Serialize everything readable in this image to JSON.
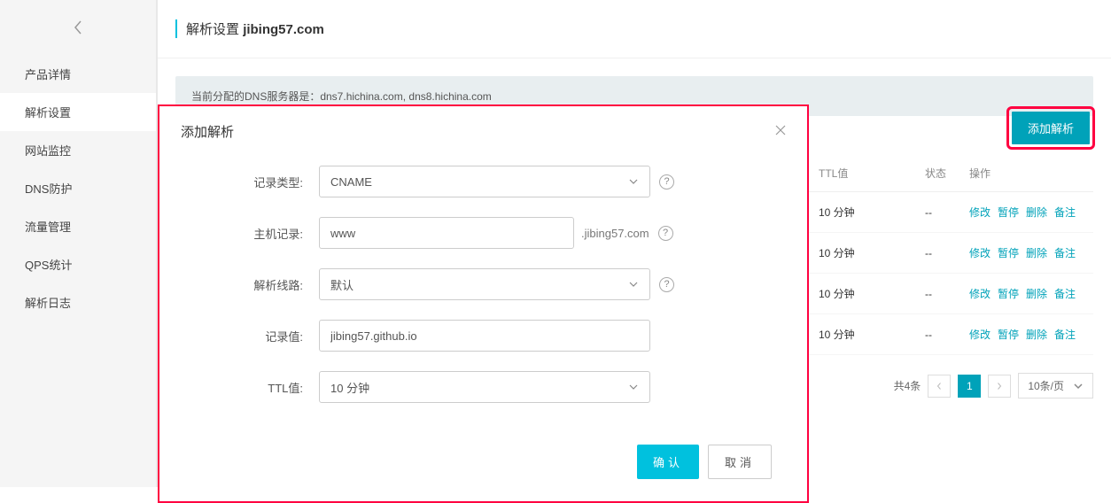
{
  "sidebar": {
    "items": [
      {
        "label": "产品详情"
      },
      {
        "label": "解析设置"
      },
      {
        "label": "网站监控"
      },
      {
        "label": "DNS防护"
      },
      {
        "label": "流量管理"
      },
      {
        "label": "QPS统计"
      },
      {
        "label": "解析日志"
      }
    ],
    "active_index": 1
  },
  "header": {
    "title_prefix": "解析设置",
    "domain": "jibing57.com"
  },
  "dns_info": "当前分配的DNS服务器是：dns7.hichina.com, dns8.hichina.com",
  "add_record_btn": "添加解析",
  "table": {
    "headers": {
      "ttl": "TTL值",
      "status": "状态",
      "action": "操作"
    },
    "rows": [
      {
        "ttl": "10 分钟",
        "status": "--"
      },
      {
        "ttl": "10 分钟",
        "status": "--"
      },
      {
        "ttl": "10 分钟",
        "status": "--"
      },
      {
        "ttl": "10 分钟",
        "status": "--"
      }
    ],
    "actions": {
      "modify": "修改",
      "pause": "暂停",
      "delete": "删除",
      "remark": "备注"
    }
  },
  "pagination": {
    "total_label": "共4条",
    "current": "1",
    "page_size": "10条/页"
  },
  "modal": {
    "title": "添加解析",
    "fields": {
      "record_type": {
        "label": "记录类型:",
        "value": "CNAME"
      },
      "host": {
        "label": "主机记录:",
        "value": "www",
        "suffix": ".jibing57.com"
      },
      "line": {
        "label": "解析线路:",
        "value": "默认"
      },
      "record_value": {
        "label": "记录值:",
        "value": "jibing57.github.io"
      },
      "ttl": {
        "label": "TTL值:",
        "value": "10 分钟"
      }
    },
    "confirm": "确认",
    "cancel": "取消"
  }
}
